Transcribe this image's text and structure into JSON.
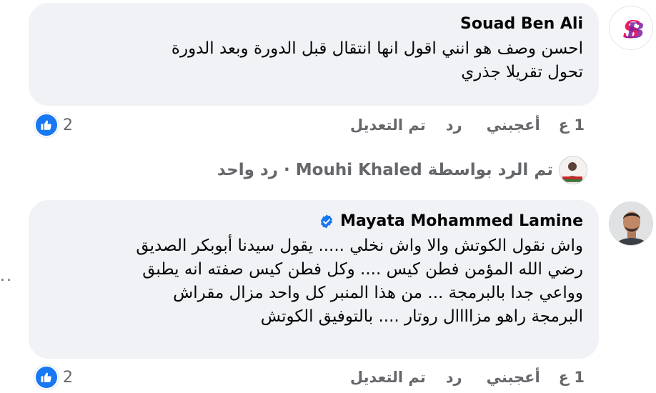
{
  "comments": [
    {
      "author": "Souad Ben Ali",
      "avatar_monogram": "SB",
      "text_lines": [
        "احسن وصف هو انني اقول انها انتقال قبل الدورة وبعد الدورة",
        "تحول تقريلا جذري"
      ],
      "time": "1 ع",
      "like_label": "أعجبني",
      "reply_label": "رد",
      "edited_label": "تم التعديل",
      "reaction_count": "2"
    },
    {
      "author": "Mayata Mohammed Lamine",
      "verified": true,
      "text_lines": [
        "واش نقول الكوتش والا واش نخلي ..... يقول سيدنا أبوبكر الصديق",
        "رضي الله المؤمن فطن كيس .... وكل فطن كيس صفته انه يطبق",
        "وواعي جدا بالبرمجة ... من هذا المنبر كل واحد مزال مقراش",
        "البرمجة راهو مزاااال روتار .... بالتوفيق الكوتش"
      ],
      "time": "1 ع",
      "like_label": "أعجبني",
      "reply_label": "رد",
      "edited_label": "تم التعديل",
      "reaction_count": "2"
    }
  ],
  "reply_summary": {
    "prefix": "تم الرد بواسطة",
    "name": "Mouhi Khaled",
    "separator": "·",
    "count_text": "رد واحد"
  },
  "more_dots": "..",
  "colors": {
    "bubble": "#f0f2f5",
    "secondary_text": "#65676b",
    "like_blue": "#1877f2",
    "monogram_pink": "#e91e63",
    "monogram_purple": "#7b1fa2"
  }
}
